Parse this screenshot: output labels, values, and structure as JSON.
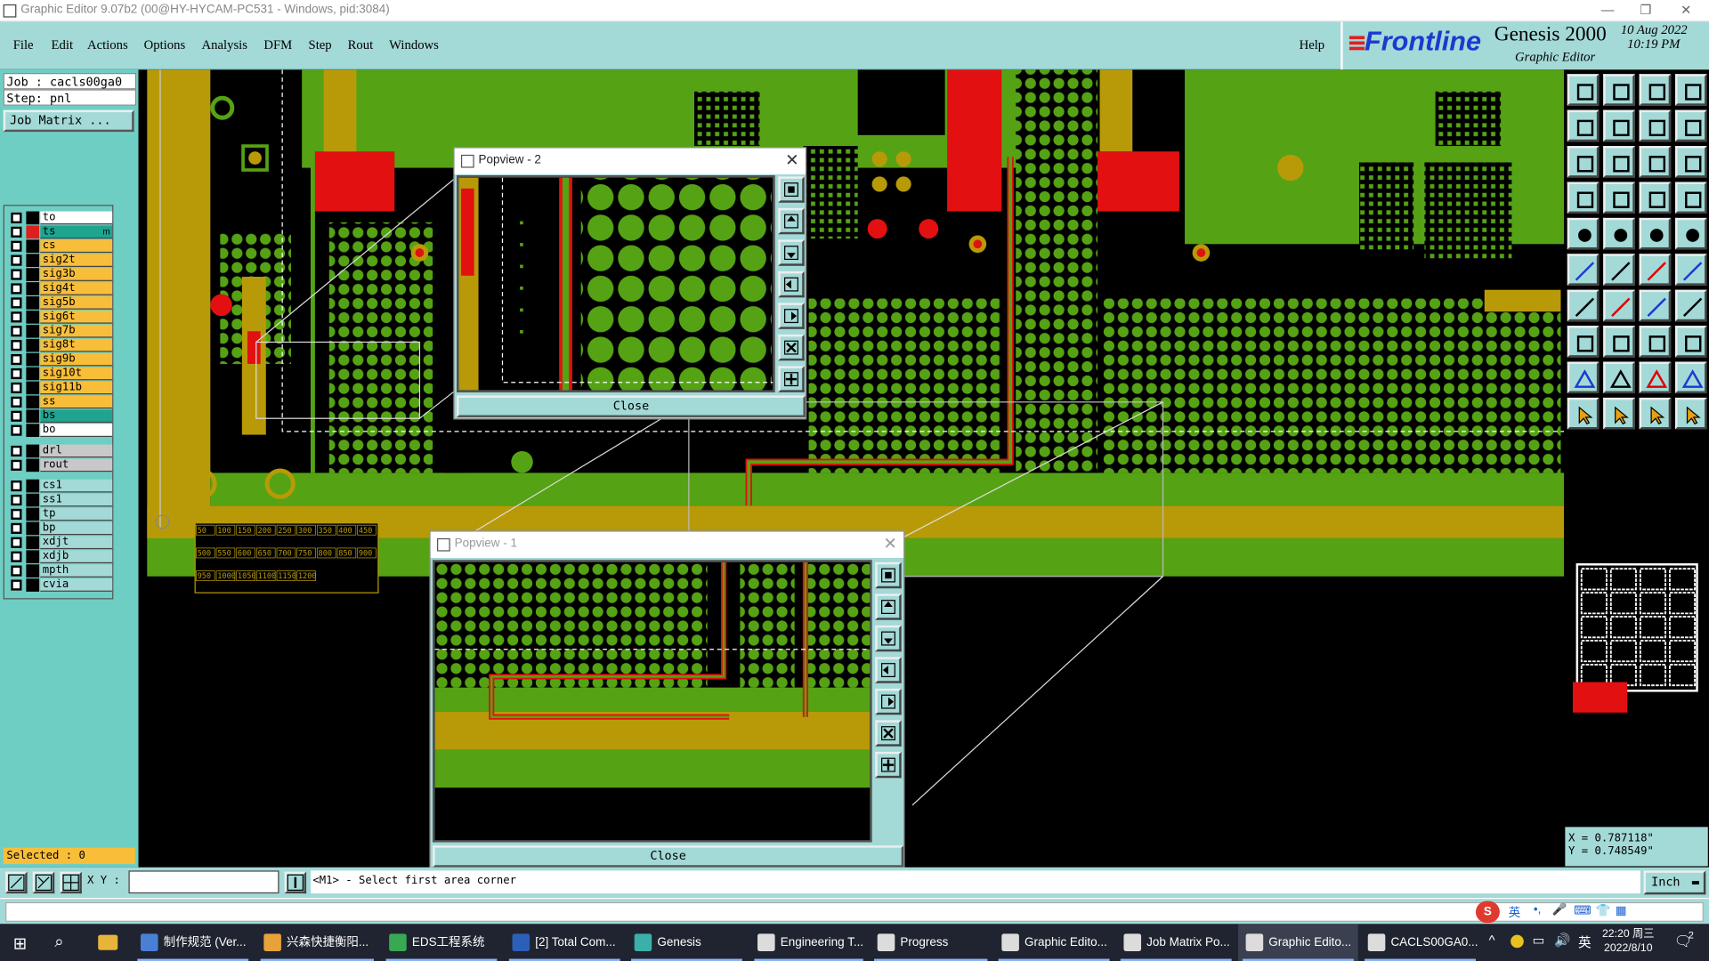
{
  "window": {
    "title": "Graphic Editor 9.07b2 (00@HY-HYCAM-PC531 - Windows, pid:3084)"
  },
  "menu": [
    "File",
    "Edit",
    "Actions",
    "Options",
    "Analysis",
    "DFM",
    "Step",
    "Rout",
    "Windows"
  ],
  "help_label": "Help",
  "brand": {
    "logo": "Frontline",
    "product": "Genesis 2000",
    "subtitle": "Graphic Editor",
    "date_line1": "10  Aug  2022",
    "date_line2": "10:19  PM"
  },
  "job": {
    "job_line": "Job : cacls00ga0",
    "step_line": "Step: pnl",
    "matrix_button": "Job Matrix ..."
  },
  "layers": [
    {
      "name": "to",
      "swatch": "#000000",
      "bg": "#ffffff"
    },
    {
      "name": "ts",
      "swatch": "#e01e1e",
      "bg": "#1fa58f",
      "flag": "m"
    },
    {
      "name": "cs",
      "swatch": "#000000",
      "bg": "#f8be39"
    },
    {
      "name": "sig2t",
      "swatch": "#000000",
      "bg": "#f8be39"
    },
    {
      "name": "sig3b",
      "swatch": "#000000",
      "bg": "#f8be39"
    },
    {
      "name": "sig4t",
      "swatch": "#000000",
      "bg": "#f8be39"
    },
    {
      "name": "sig5b",
      "swatch": "#000000",
      "bg": "#f8be39"
    },
    {
      "name": "sig6t",
      "swatch": "#000000",
      "bg": "#f8be39"
    },
    {
      "name": "sig7b",
      "swatch": "#000000",
      "bg": "#f8be39"
    },
    {
      "name": "sig8t",
      "swatch": "#000000",
      "bg": "#f8be39"
    },
    {
      "name": "sig9b",
      "swatch": "#000000",
      "bg": "#f8be39"
    },
    {
      "name": "sig10t",
      "swatch": "#000000",
      "bg": "#f8be39"
    },
    {
      "name": "sig11b",
      "swatch": "#000000",
      "bg": "#f8be39"
    },
    {
      "name": "ss",
      "swatch": "#000000",
      "bg": "#f8be39"
    },
    {
      "name": "bs",
      "swatch": "#000000",
      "bg": "#1fa58f"
    },
    {
      "name": "bo",
      "swatch": "#000000",
      "bg": "#ffffff"
    },
    {
      "name": "drl",
      "swatch": "#000000",
      "bg": "#c8c8c8"
    },
    {
      "name": "rout",
      "swatch": "#000000",
      "bg": "#c8c8c8"
    },
    {
      "name": "cs1",
      "swatch": "#000000",
      "bg": "#a3d9d7"
    },
    {
      "name": "ss1",
      "swatch": "#000000",
      "bg": "#a3d9d7"
    },
    {
      "name": "tp",
      "swatch": "#000000",
      "bg": "#a3d9d7"
    },
    {
      "name": "bp",
      "swatch": "#000000",
      "bg": "#a3d9d7"
    },
    {
      "name": "xdjt",
      "swatch": "#000000",
      "bg": "#a3d9d7"
    },
    {
      "name": "xdjb",
      "swatch": "#000000",
      "bg": "#a3d9d7"
    },
    {
      "name": "mpth",
      "swatch": "#000000",
      "bg": "#a3d9d7"
    },
    {
      "name": "cvia",
      "swatch": "#000000",
      "bg": "#a3d9d7"
    }
  ],
  "selected_count": "Selected : 0",
  "popview2": {
    "title": "Popview - 2",
    "close": "Close"
  },
  "popview1": {
    "title": "Popview - 1",
    "close": "Close"
  },
  "coords": {
    "x": "X = 0.787118\"",
    "y": "Y = 0.748549\""
  },
  "command": {
    "xy_label": "X Y :",
    "prompt": "<M1> - Select first area corner",
    "unit": "Inch"
  },
  "table_labels": {
    "row1": [
      "50",
      "100",
      "150",
      "200",
      "250",
      "300",
      "350",
      "400",
      "450"
    ],
    "row2": [
      "500",
      "550",
      "600",
      "650",
      "700",
      "750",
      "800",
      "850",
      "900"
    ],
    "row3": [
      "950",
      "1000",
      "1050",
      "1100",
      "1150",
      "1200"
    ]
  },
  "taskbar": {
    "items": [
      {
        "label": "制作规范 (Ver...",
        "color": "#4a7fd6"
      },
      {
        "label": "兴森快捷衡阳...",
        "color": "#e8a23a"
      },
      {
        "label": "EDS工程系统",
        "color": "#38a852"
      },
      {
        "label": "[2] Total Com...",
        "color": "#2b5fb8"
      },
      {
        "label": "Genesis",
        "color": "#3ab0a8"
      },
      {
        "label": "Engineering T...",
        "color": "#dcdcdc"
      },
      {
        "label": "Progress",
        "color": "#dcdcdc"
      },
      {
        "label": "Graphic Edito...",
        "color": "#dcdcdc"
      },
      {
        "label": "Job Matrix Po...",
        "color": "#dcdcdc"
      },
      {
        "label": "Graphic Edito...",
        "color": "#dcdcdc"
      },
      {
        "label": "CACLS00GA0...",
        "color": "#dcdcdc"
      }
    ],
    "ime": "英",
    "clock_time": "22:20 周三",
    "clock_date": "2022/8/10",
    "notifications": "2"
  },
  "colors": {
    "board_green": "#55a314",
    "copper_gold": "#b89a08",
    "pad_green": "#55a314",
    "panel_bg": "#6ecec4",
    "menu_bg": "#a3d9d7",
    "trace_red": "#e21010"
  }
}
